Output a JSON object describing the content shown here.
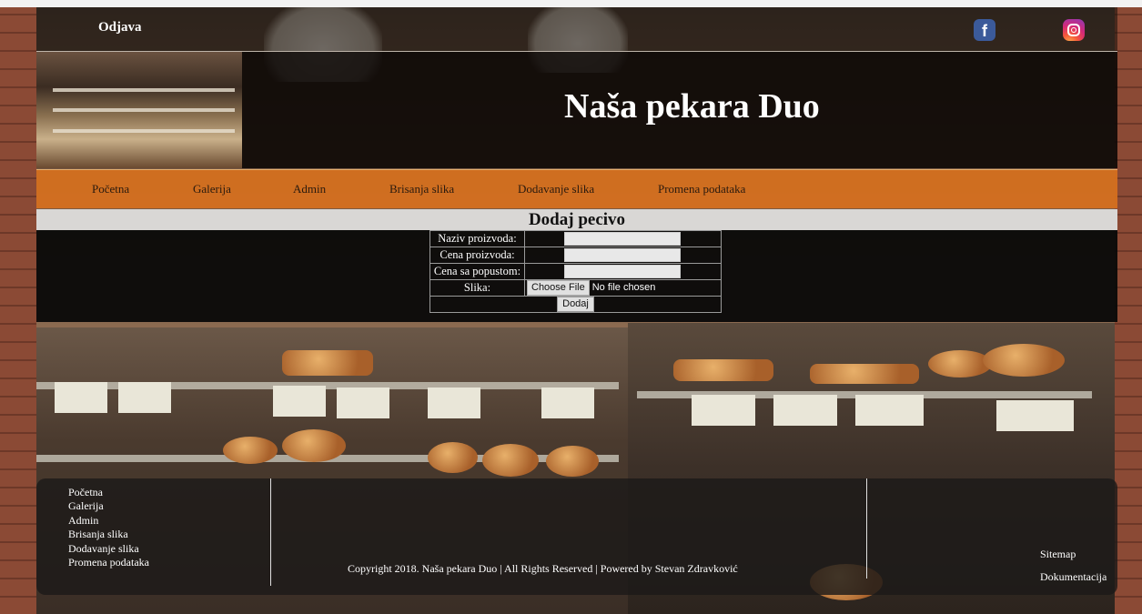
{
  "header": {
    "logout_label": "Odjava",
    "social": {
      "facebook_icon": "facebook-icon",
      "instagram_icon": "instagram-icon"
    }
  },
  "banner": {
    "title": "Naša pekara Duo"
  },
  "nav": {
    "items": [
      "Početna",
      "Galerija",
      "Admin",
      "Brisanja slika",
      "Dodavanje slika",
      "Promena podataka"
    ]
  },
  "form": {
    "heading": "Dodaj pecivo",
    "name_label": "Naziv proizvoda:",
    "price_label": "Cena proizvoda:",
    "discount_label": "Cena sa popustom:",
    "image_label": "Slika:",
    "file_button_label": "Choose File",
    "file_status": "No file chosen",
    "submit_label": "Dodaj"
  },
  "footer": {
    "links": [
      "Početna",
      "Galerija",
      "Admin",
      "Brisanja slika",
      "Dodavanje slika",
      "Promena podataka"
    ],
    "copyright": "Copyright 2018. Naša pekara Duo | All Rights Reserved | Powered by Stevan Zdravković",
    "sitemap_label": "Sitemap",
    "docs_label": "Dokumentacija"
  },
  "colors": {
    "nav_orange": "#d6701e",
    "header_dark": "#0c0806",
    "form_heading_bg": "#d9d7d5",
    "facebook_blue": "#3b5a9a"
  }
}
